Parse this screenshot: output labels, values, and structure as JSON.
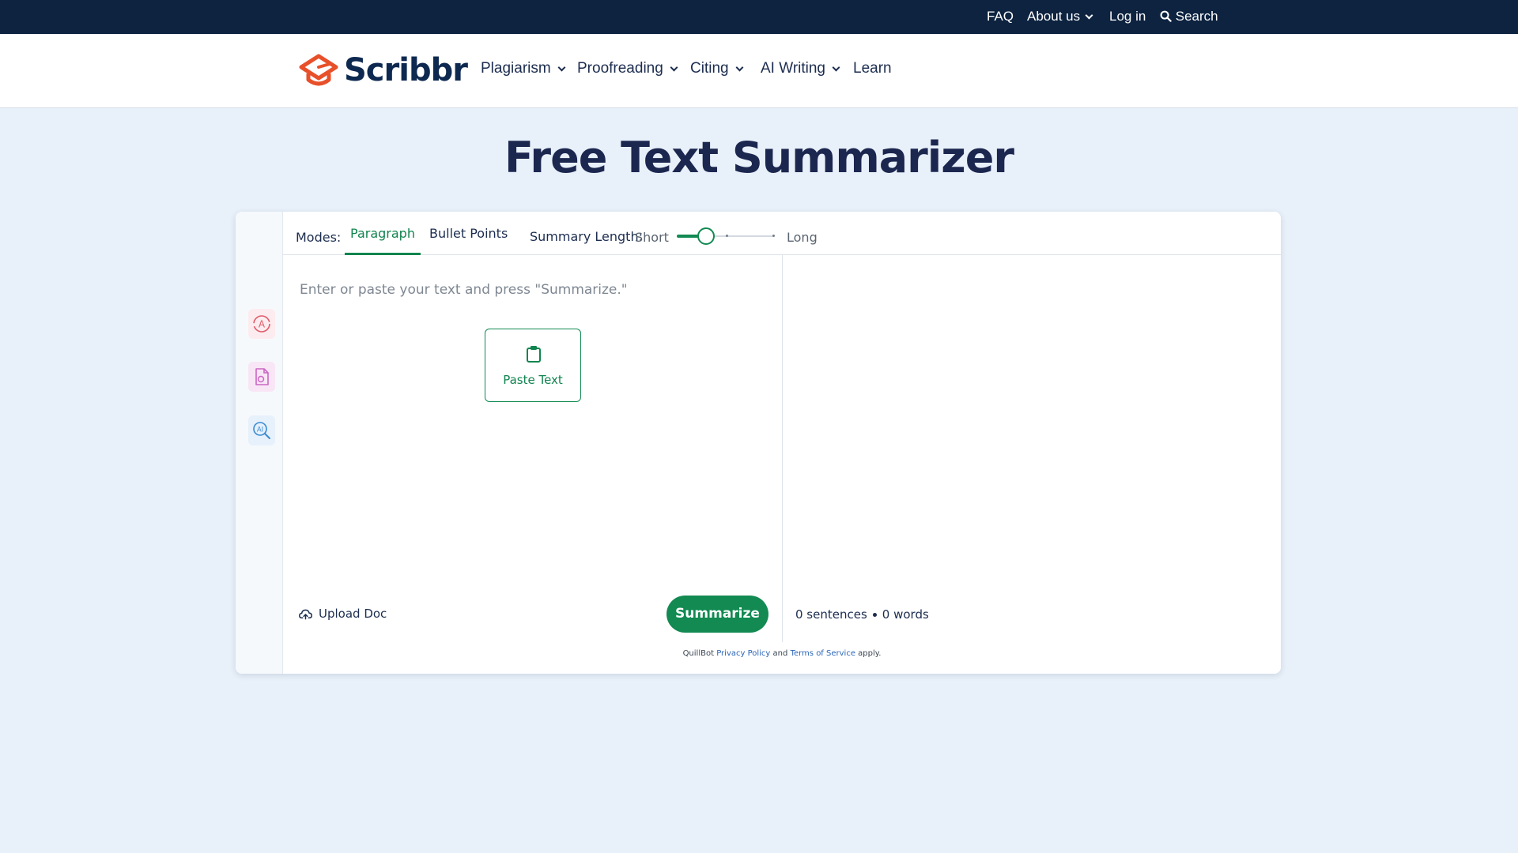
{
  "topbar": {
    "faq": "FAQ",
    "about": "About us",
    "login": "Log in",
    "search": "Search"
  },
  "brand": {
    "name": "Scribbr",
    "logo_color": "#e8502a"
  },
  "nav": [
    {
      "label": "Plagiarism",
      "has_dropdown": true
    },
    {
      "label": "Proofreading",
      "has_dropdown": true
    },
    {
      "label": "Citing",
      "has_dropdown": true
    },
    {
      "label": "AI Writing",
      "has_dropdown": true
    },
    {
      "label": "Learn",
      "has_dropdown": false
    }
  ],
  "page": {
    "title": "Free Text Summarizer"
  },
  "tool": {
    "modes_label": "Modes:",
    "modes": [
      {
        "label": "Paragraph",
        "active": true
      },
      {
        "label": "Bullet Points",
        "active": false
      }
    ],
    "length_label": "Summary Length:",
    "length_short": "Short",
    "length_long": "Long",
    "length_level": 0.3,
    "input_placeholder": "Enter or paste your text and press \"Summarize.\"",
    "paste_label": "Paste Text",
    "upload_label": "Upload Doc",
    "summarize_label": "Summarize",
    "stats": {
      "sentences": "0 sentences",
      "words": "0 words"
    },
    "legal": {
      "prefix": "QuillBot",
      "privacy": "Privacy Policy",
      "and": "and",
      "terms": "Terms of Service",
      "suffix": "apply."
    },
    "sidebar_icons": [
      "paraphraser-icon",
      "document-icon",
      "ai-detector-icon"
    ]
  },
  "colors": {
    "topbar_bg": "#0d2340",
    "page_bg": "#e8f0f9",
    "accent_green": "#128a52",
    "title_navy": "#1c2750"
  }
}
